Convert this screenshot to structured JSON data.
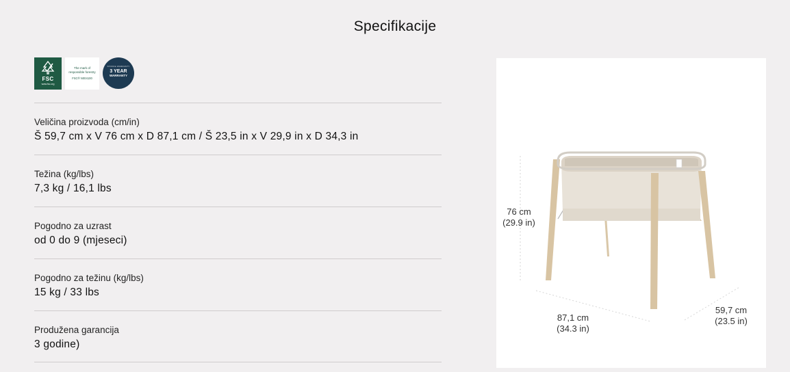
{
  "section": {
    "title": "Specifikacije"
  },
  "badges": {
    "fsc": {
      "logo_text": "FSC",
      "url": "www.fsc.org"
    },
    "fsc_label": {
      "line1": "The mark of",
      "line2": "responsible forestry",
      "license": "FSC® N004100"
    },
    "warranty": {
      "top": "STOKKE WARRANTY",
      "main": "3 YEAR",
      "sub": "WARRANTY"
    },
    "colors": {
      "fsc_green": "#1f5a43",
      "warranty_blue": "#1d3a52"
    }
  },
  "specs": [
    {
      "label": "Veličina proizvoda (cm/in)",
      "value": "Š 59,7 cm x V 76 cm x D 87,1 cm / Š 23,5 in x V 29,9 in x D 34,3 in"
    },
    {
      "label": "Težina (kg/lbs)",
      "value": "7,3 kg / 16,1 lbs"
    },
    {
      "label": "Pogodno za uzrast",
      "value": "od 0 do 9 (mjeseci)"
    },
    {
      "label": "Pogodno za težinu (kg/lbs)",
      "value": "15 kg / 33 lbs"
    },
    {
      "label": "Produžena garancija",
      "value": "3 godine)"
    }
  ],
  "product_image": {
    "height_cm": "76 cm",
    "height_in": "(29.9 in)",
    "length_cm": "87,1 cm",
    "length_in": "(34.3 in)",
    "width_cm": "59,7 cm",
    "width_in": "(23.5 in)"
  }
}
